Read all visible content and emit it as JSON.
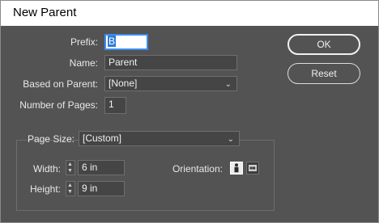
{
  "window": {
    "title": "New Parent"
  },
  "form": {
    "prefix_label": "Prefix:",
    "prefix_value": "B",
    "name_label": "Name:",
    "name_value": "Parent",
    "based_on_label": "Based on Parent:",
    "based_on_value": "[None]",
    "num_pages_label": "Number of Pages:",
    "num_pages_value": "1"
  },
  "page_size": {
    "label": "Page Size:",
    "value": "[Custom]",
    "width_label": "Width:",
    "width_value": "6 in",
    "height_label": "Height:",
    "height_value": "9 in",
    "orientation_label": "Orientation:",
    "orientation_selected": "portrait"
  },
  "buttons": {
    "ok": "OK",
    "reset": "Reset"
  },
  "icons": {
    "dropdown": "chevron-down-icon",
    "spin_up": "caret-up-icon",
    "spin_down": "caret-down-icon",
    "portrait": "portrait-orientation-icon",
    "landscape": "landscape-orientation-icon"
  }
}
